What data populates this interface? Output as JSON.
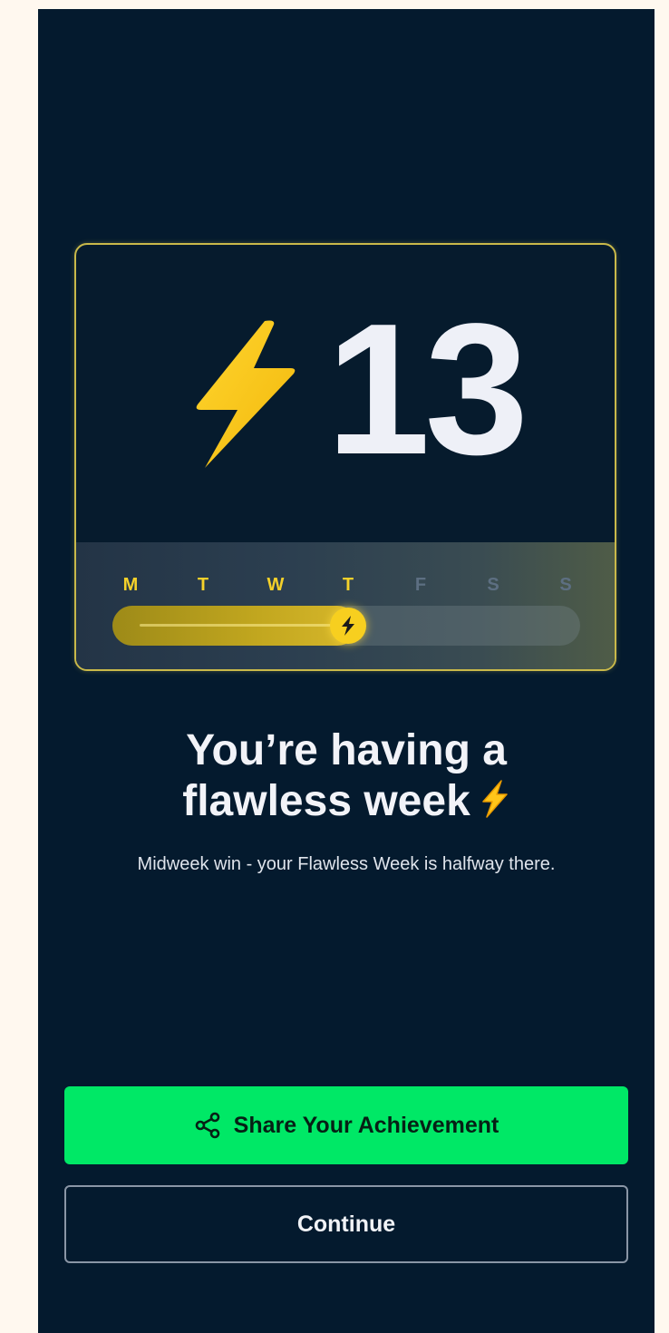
{
  "streak": {
    "count": "13",
    "days": [
      {
        "label": "M",
        "active": true
      },
      {
        "label": "T",
        "active": true
      },
      {
        "label": "W",
        "active": true
      },
      {
        "label": "T",
        "active": true
      },
      {
        "label": "F",
        "active": false
      },
      {
        "label": "S",
        "active": false
      },
      {
        "label": "S",
        "active": false
      }
    ],
    "progress_days_completed": 4,
    "progress_days_total": 7
  },
  "headline": {
    "line1": "You’re having a",
    "line2": "flawless week"
  },
  "subtext": "Midweek win - your Flawless Week is halfway there.",
  "actions": {
    "share_label": "Share Your Achievement",
    "continue_label": "Continue"
  },
  "icons": {
    "streak": "lightning-bolt-icon",
    "share": "share-icon",
    "headline": "lightning-bolt-icon"
  },
  "colors": {
    "background": "#041a2e",
    "accent_yellow": "#f7cf1f",
    "share_button": "#00e866",
    "active_day": "#f5d12a",
    "inactive_day": "#5d6f82"
  }
}
